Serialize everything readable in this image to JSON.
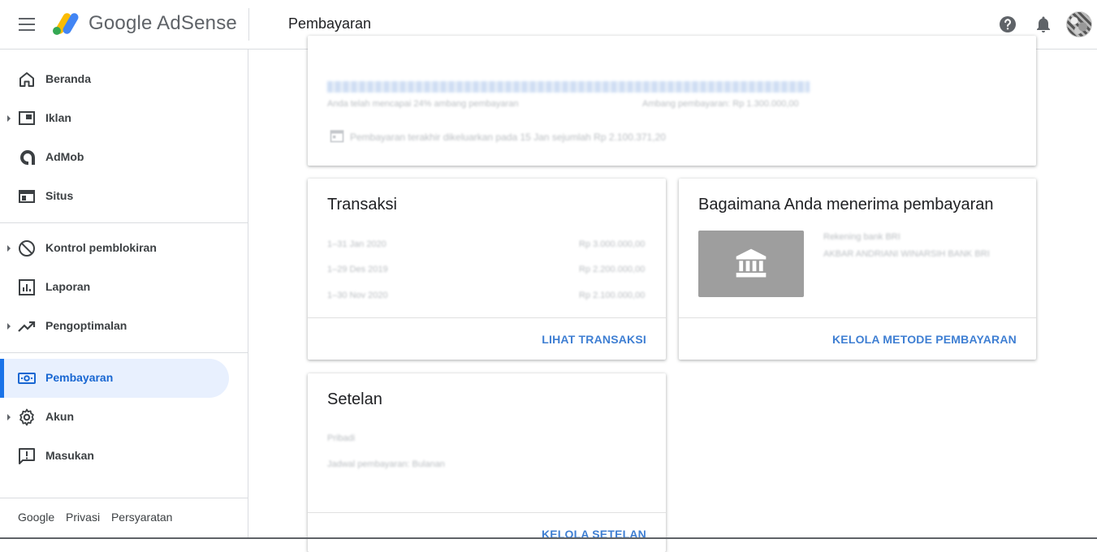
{
  "header": {
    "app_name": "Google AdSense",
    "page_title": "Pembayaran"
  },
  "sidebar": {
    "items": [
      {
        "label": "Beranda",
        "icon": "home-icon"
      },
      {
        "label": "Iklan",
        "icon": "ads-icon",
        "expandable": true
      },
      {
        "label": "AdMob",
        "icon": "admob-icon"
      },
      {
        "label": "Situs",
        "icon": "sites-icon"
      },
      {
        "label": "Kontrol pemblokiran",
        "icon": "block-icon",
        "expandable": true
      },
      {
        "label": "Laporan",
        "icon": "report-icon"
      },
      {
        "label": "Pengoptimalan",
        "icon": "trending-icon",
        "expandable": true
      },
      {
        "label": "Pembayaran",
        "icon": "payments-icon",
        "active": true
      },
      {
        "label": "Akun",
        "icon": "gear-icon",
        "expandable": true
      },
      {
        "label": "Masukan",
        "icon": "feedback-icon"
      }
    ],
    "footer": {
      "google": "Google",
      "privacy": "Privasi",
      "terms": "Persyaratan"
    }
  },
  "balance_card": {
    "progress_text": "Anda telah mencapai 24% ambang pembayaran",
    "threshold_text": "Ambang pembayaran: Rp 1.300.000,00",
    "last_payment_text": "Pembayaran terakhir dikeluarkan pada 15 Jan sejumlah Rp 2.100.371,20"
  },
  "transactions_card": {
    "title": "Transaksi",
    "rows": [
      {
        "period": "1–31 Jan 2020",
        "amount": "Rp 3.000.000,00"
      },
      {
        "period": "1–29 Des 2019",
        "amount": "Rp 2.200.000,00"
      },
      {
        "period": "1–30 Nov 2020",
        "amount": "Rp 2.100.000,00"
      }
    ],
    "link": "LIHAT TRANSAKSI"
  },
  "payment_method_card": {
    "title": "Bagaimana Anda menerima pembayaran",
    "line1": "Rekening bank BRI",
    "line2": "AKBAR ANDRIANI WINARSIH BANK BRI",
    "link": "KELOLA METODE PEMBAYARAN"
  },
  "settings_card": {
    "title": "Setelan",
    "line1": "Pribadi",
    "line2": "Jadwal pembayaran: Bulanan",
    "link": "KELOLA SETELAN"
  },
  "colors": {
    "accent": "#1a73e8",
    "active_bg": "#e8f0fe",
    "link": "#3f7fd3"
  }
}
